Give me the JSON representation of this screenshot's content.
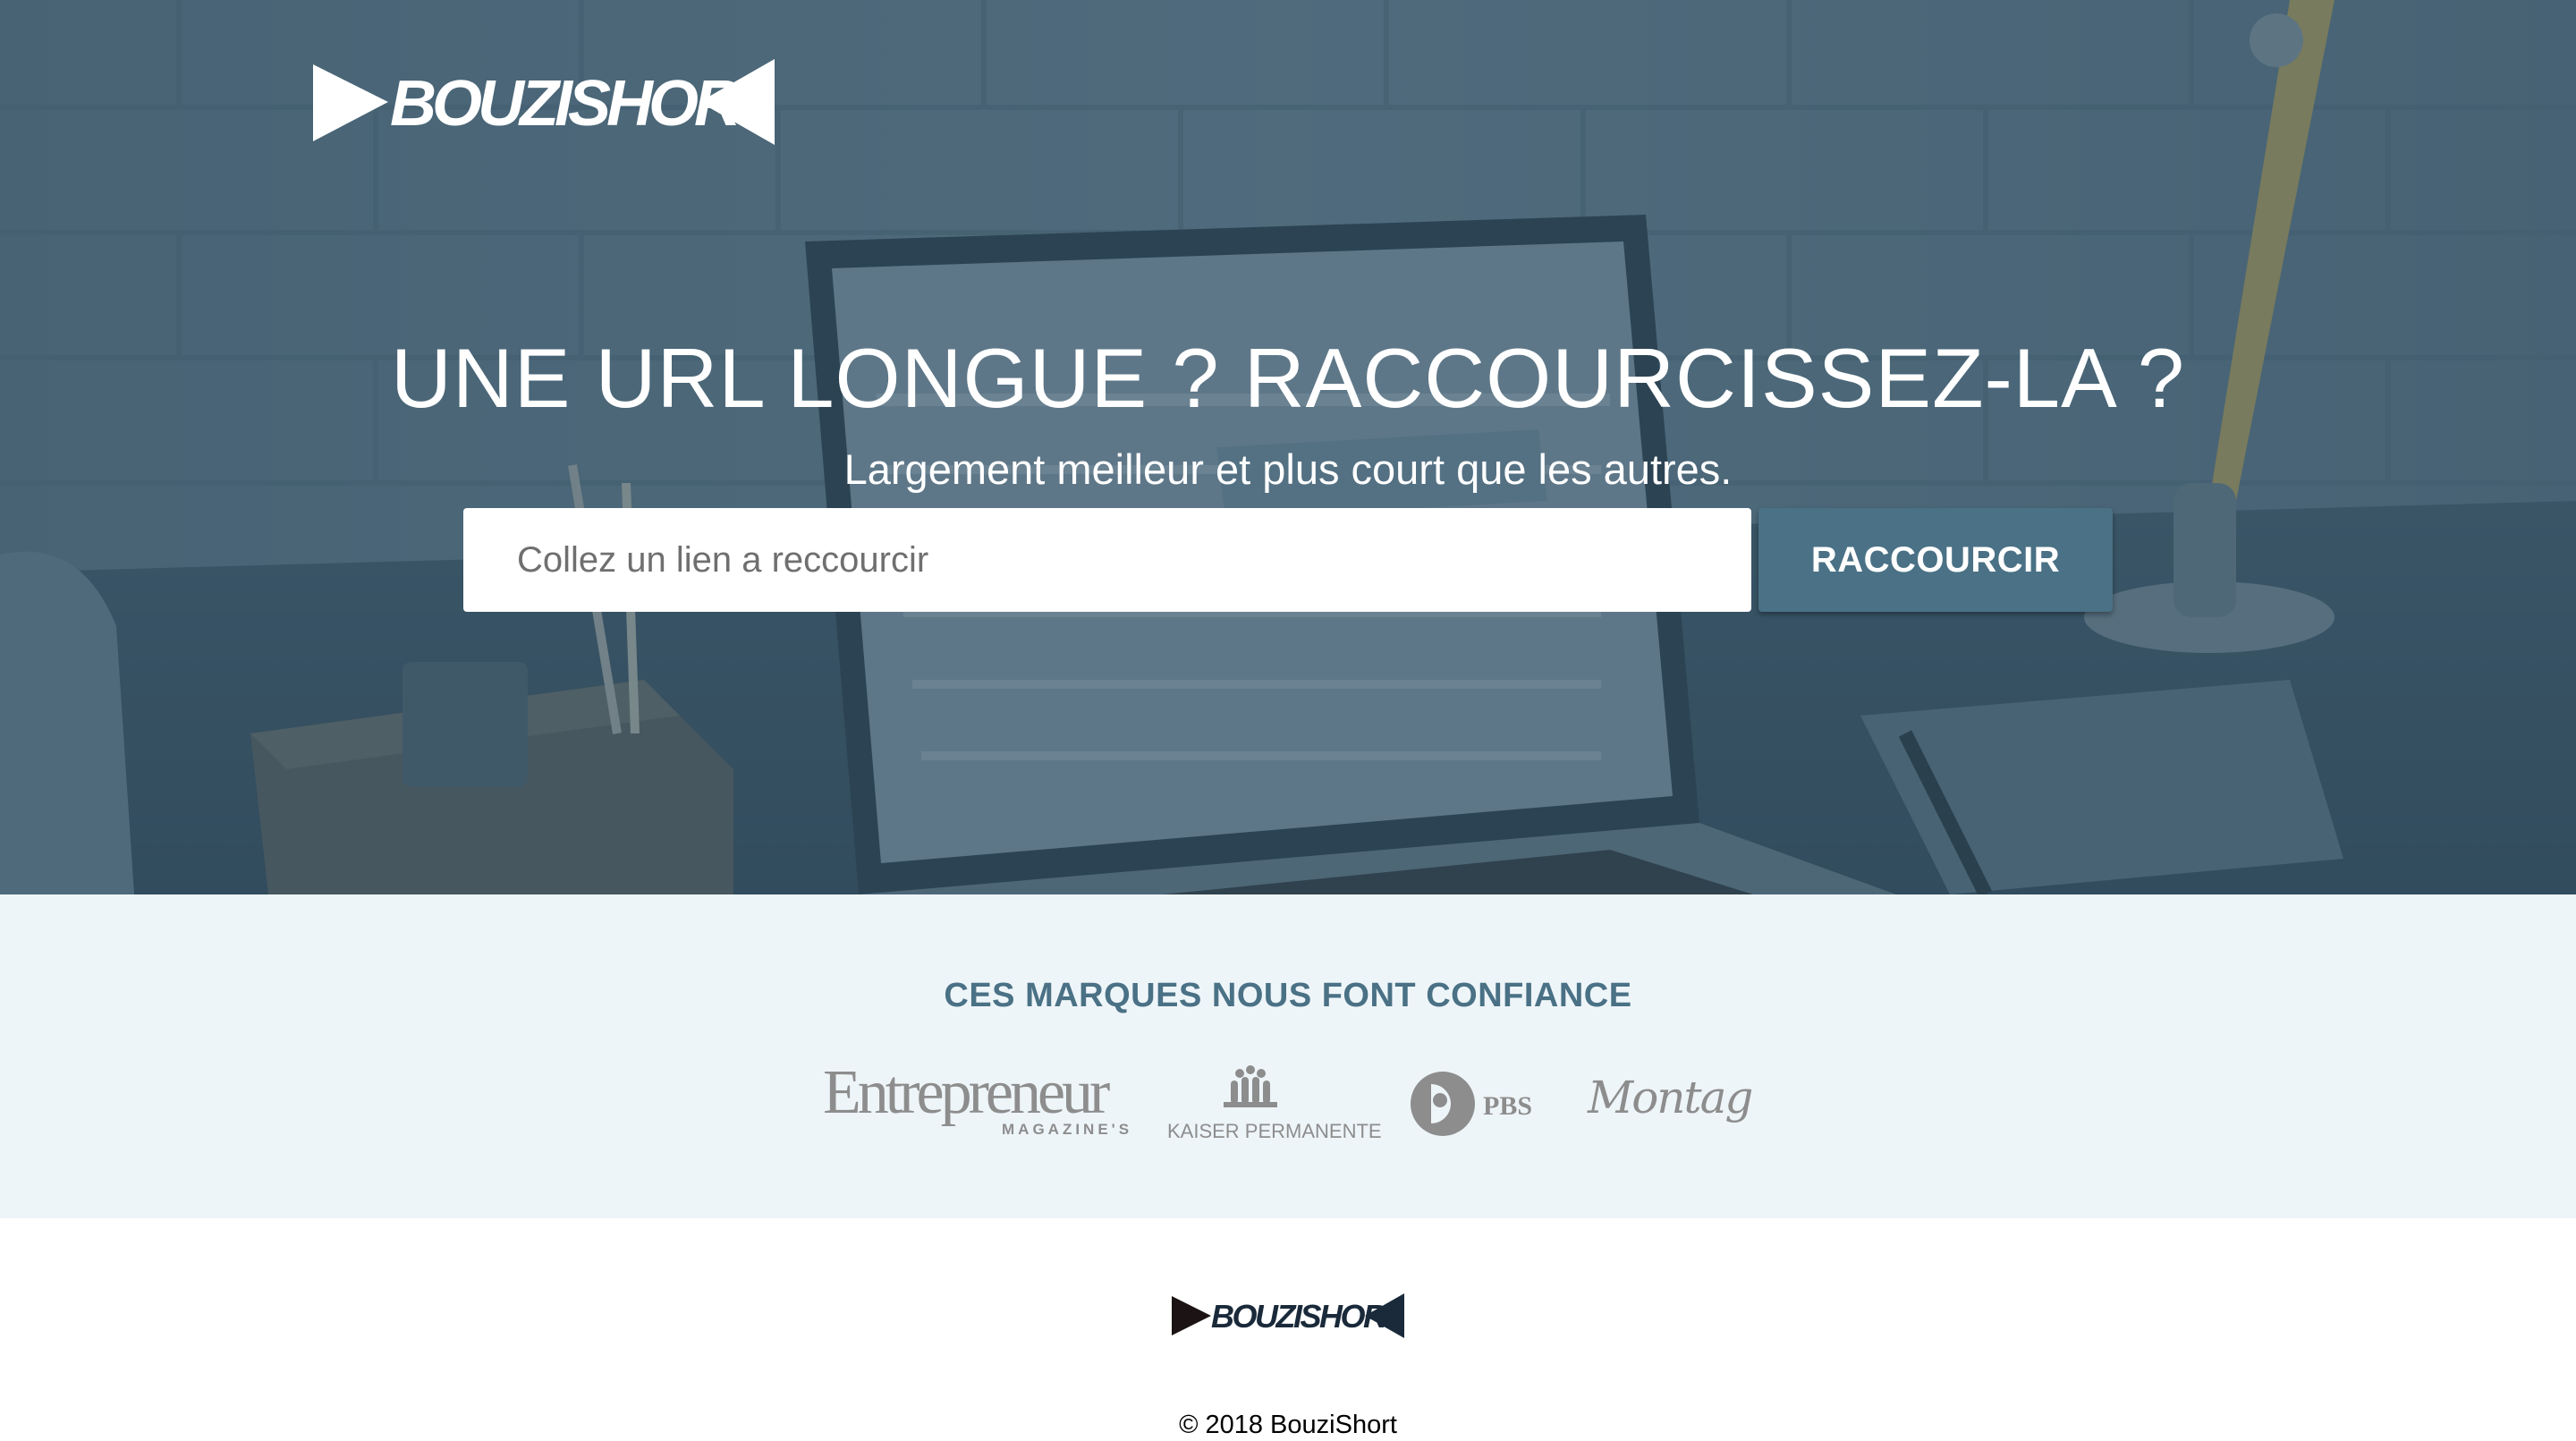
{
  "brand": {
    "name": "BOUZISHORT",
    "logo_color_hero": "#ffffff",
    "logo_color_footer": "#1a2a3a"
  },
  "hero": {
    "title": "UNE URL LONGUE ? RACCOURCISSEZ-LA ?",
    "subtitle": "Largement meilleur et plus court que les autres.",
    "background_image": "laptop-on-desk-photo",
    "overlay_color": "#375569"
  },
  "shorten_form": {
    "input_value": "",
    "input_placeholder": "Collez un lien a reccourcir",
    "button_label": "RACCOURCIR",
    "button_color": "#4a7185"
  },
  "brands": {
    "title": "CES MARQUES NOUS FONT CONFIANCE",
    "background": "#eef5f9",
    "title_color": "#4a7185",
    "logos": [
      {
        "name": "Entrepreneur",
        "sub": "MAGAZINE'S",
        "icon": "entrepreneur-logo"
      },
      {
        "name": "KAISER PERMANENTE",
        "icon": "kaiser-permanente-logo"
      },
      {
        "name": "PBS",
        "icon": "pbs-logo"
      },
      {
        "name": "Montage",
        "icon": "montage-logo"
      }
    ]
  },
  "footer": {
    "copyright": "© 2018 BouziShort"
  }
}
